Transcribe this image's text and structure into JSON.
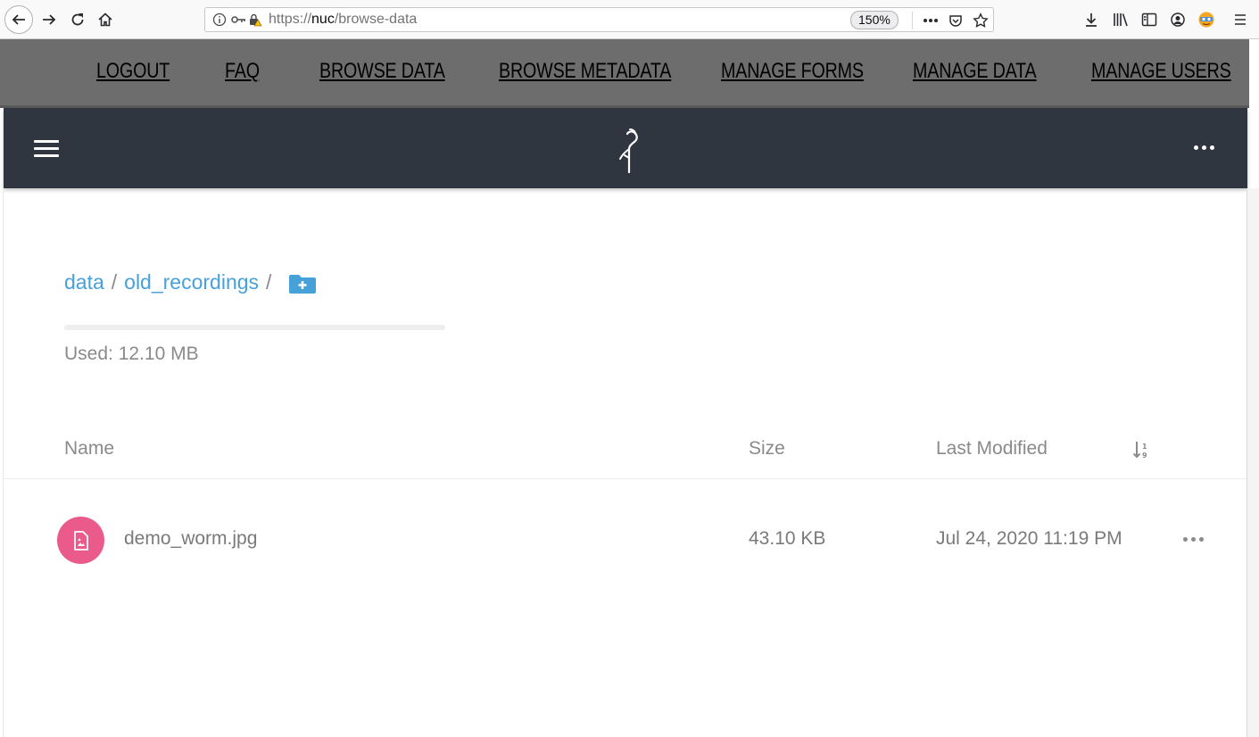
{
  "browser": {
    "url_prefix": "https://",
    "url_host": "nuc",
    "url_path": "/browse-data",
    "zoom": "150%",
    "icons": [
      "back-icon",
      "forward-icon",
      "reload-icon",
      "home-icon",
      "info-icon",
      "key-icon",
      "insecure-lock-icon",
      "page-actions-icon",
      "pocket-icon",
      "bookmark-star-icon",
      "download-icon",
      "library-icon",
      "sidebar-icon",
      "account-icon",
      "extension-icon",
      "menu-icon"
    ]
  },
  "site_menu": {
    "items": [
      "LOGOUT",
      "FAQ",
      "BROWSE DATA",
      "BROWSE METADATA",
      "MANAGE FORMS",
      "MANAGE DATA",
      "MANAGE USERS"
    ]
  },
  "app_header": {
    "icons": [
      "hamburger-icon",
      "minio-logo",
      "more-options-icon"
    ]
  },
  "breadcrumb": {
    "items": [
      "data",
      "old_recordings"
    ],
    "separator": "/"
  },
  "storage": {
    "used_label": "Used: 12.10 MB",
    "used_fraction": 0.0
  },
  "table": {
    "columns": [
      "Name",
      "Size",
      "Last Modified"
    ],
    "rows": [
      {
        "name": "demo_worm.jpg",
        "size": "43.10 KB",
        "modified": "Jul 24, 2020 11:19 PM",
        "icon": "image-file-icon"
      }
    ]
  },
  "colors": {
    "accent": "#46a1d9",
    "header_bg": "#2f3640",
    "menu_bg": "#6d6d6d",
    "file_icon_bg": "#ea5b8b"
  }
}
